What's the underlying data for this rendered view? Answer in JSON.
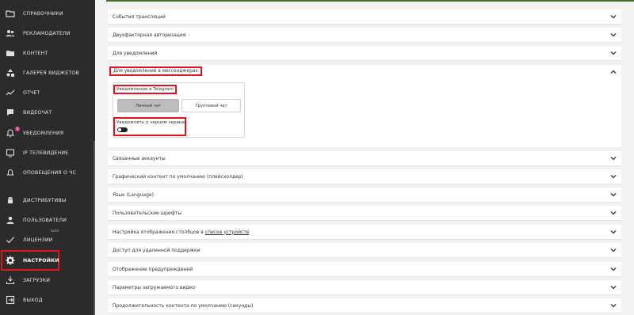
{
  "sidebar": {
    "items": [
      {
        "label": "СПРАВОЧНИКИ",
        "icon": "folder-icon"
      },
      {
        "label": "РЕКЛАМОДАТЕЛИ",
        "icon": "users-icon"
      },
      {
        "label": "КОНТЕНТ",
        "icon": "folder-filled-icon"
      },
      {
        "label": "ГАЛЕРЕЯ ВИДЖЕТОВ",
        "icon": "shapes-icon"
      },
      {
        "label": "ОТЧЕТ",
        "icon": "chart-line-icon"
      },
      {
        "label": "ВИДЕОЧАТ",
        "icon": "chat-icon"
      },
      {
        "label": "УВЕДОМЛЕНИЯ",
        "icon": "bell-icon",
        "badge": "5"
      },
      {
        "label": "IP ТЕЛЕВИДЕНИЕ",
        "icon": "tv-icon"
      },
      {
        "label": "ОПОВЕЩЕНИЯ О ЧС",
        "icon": "alert-bell-icon"
      },
      {
        "label": "ДИСТРИБУТИВЫ",
        "icon": "android-icon"
      },
      {
        "label": "ПОЛЬЗОВАТЕЛИ",
        "icon": "user-icon"
      },
      {
        "label": "ЛИЦЕНЗИИ",
        "icon": "check-icon",
        "sup": "beta"
      },
      {
        "label": "НАСТРОЙКИ",
        "icon": "gear-icon",
        "active": true
      },
      {
        "label": "ЗАГРУЗКИ",
        "icon": "download-icon"
      },
      {
        "label": "ВЫХОД",
        "icon": "logout-icon"
      }
    ]
  },
  "settings": {
    "sections_top": [
      {
        "title": "События трансляций"
      },
      {
        "title": "Двухфакторная авторизация"
      },
      {
        "title": "Для уведомлений"
      }
    ],
    "open_section": {
      "title": "Для уведомлений в мессенджерах",
      "telegram_label": "Уведомление в Telegram",
      "buttons": {
        "personal": "Личный чат",
        "group": "Групповой чат"
      },
      "selected": "personal",
      "black_screen_label": "Уведомлять о черном экране",
      "black_screen_enabled": true
    },
    "sections_bottom": [
      {
        "title": "Связанные аккаунты"
      },
      {
        "title": "Графический контент по умолчанию (плейсхолдер)"
      },
      {
        "title": "Язык (Language)"
      },
      {
        "title": "Пользовательские шрифты"
      },
      {
        "title_prefix": "Настройка отображения столбцов в ",
        "title_link": "списке устройств"
      },
      {
        "title": "Доступ для удаленной поддержки"
      },
      {
        "title": "Отображение предупреждений"
      },
      {
        "title": "Параметры загружаемого видео"
      },
      {
        "title": "Продолжительность контента по умолчанию (секунды)"
      }
    ]
  }
}
